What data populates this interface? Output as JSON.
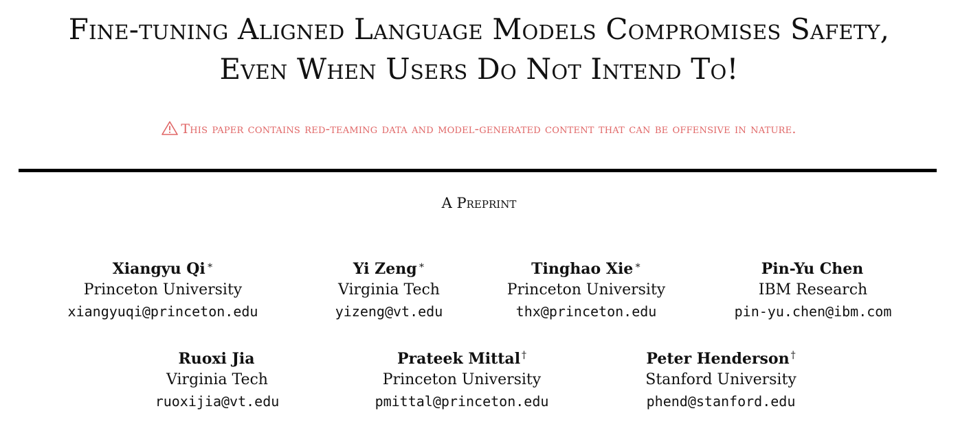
{
  "title": {
    "line1": "Fine-tuning Aligned Language Models Compromises Safety,",
    "line2": "Even When Users Do Not Intend To!"
  },
  "warning": {
    "icon": "warning-triangle-icon",
    "text": "This paper contains red-teaming data and model-generated content that can be offensive in nature.",
    "color": "#e06666"
  },
  "preprint_label": "A Preprint",
  "authors": [
    {
      "name": "Xiangyu Qi",
      "mark": "∗",
      "affiliation": "Princeton University",
      "email": "xiangyuqi@princeton.edu"
    },
    {
      "name": "Yi Zeng",
      "mark": "∗",
      "affiliation": "Virginia Tech",
      "email": "yizeng@vt.edu"
    },
    {
      "name": "Tinghao Xie",
      "mark": "∗",
      "affiliation": "Princeton University",
      "email": "thx@princeton.edu"
    },
    {
      "name": "Pin-Yu Chen",
      "mark": "",
      "affiliation": "IBM Research",
      "email": "pin-yu.chen@ibm.com"
    },
    {
      "name": "Ruoxi Jia",
      "mark": "",
      "affiliation": "Virginia Tech",
      "email": "ruoxijia@vt.edu"
    },
    {
      "name": "Prateek Mittal",
      "mark": "†",
      "affiliation": "Princeton University",
      "email": "pmittal@princeton.edu"
    },
    {
      "name": "Peter Henderson",
      "mark": "†",
      "affiliation": "Stanford University",
      "email": "phend@stanford.edu"
    }
  ]
}
